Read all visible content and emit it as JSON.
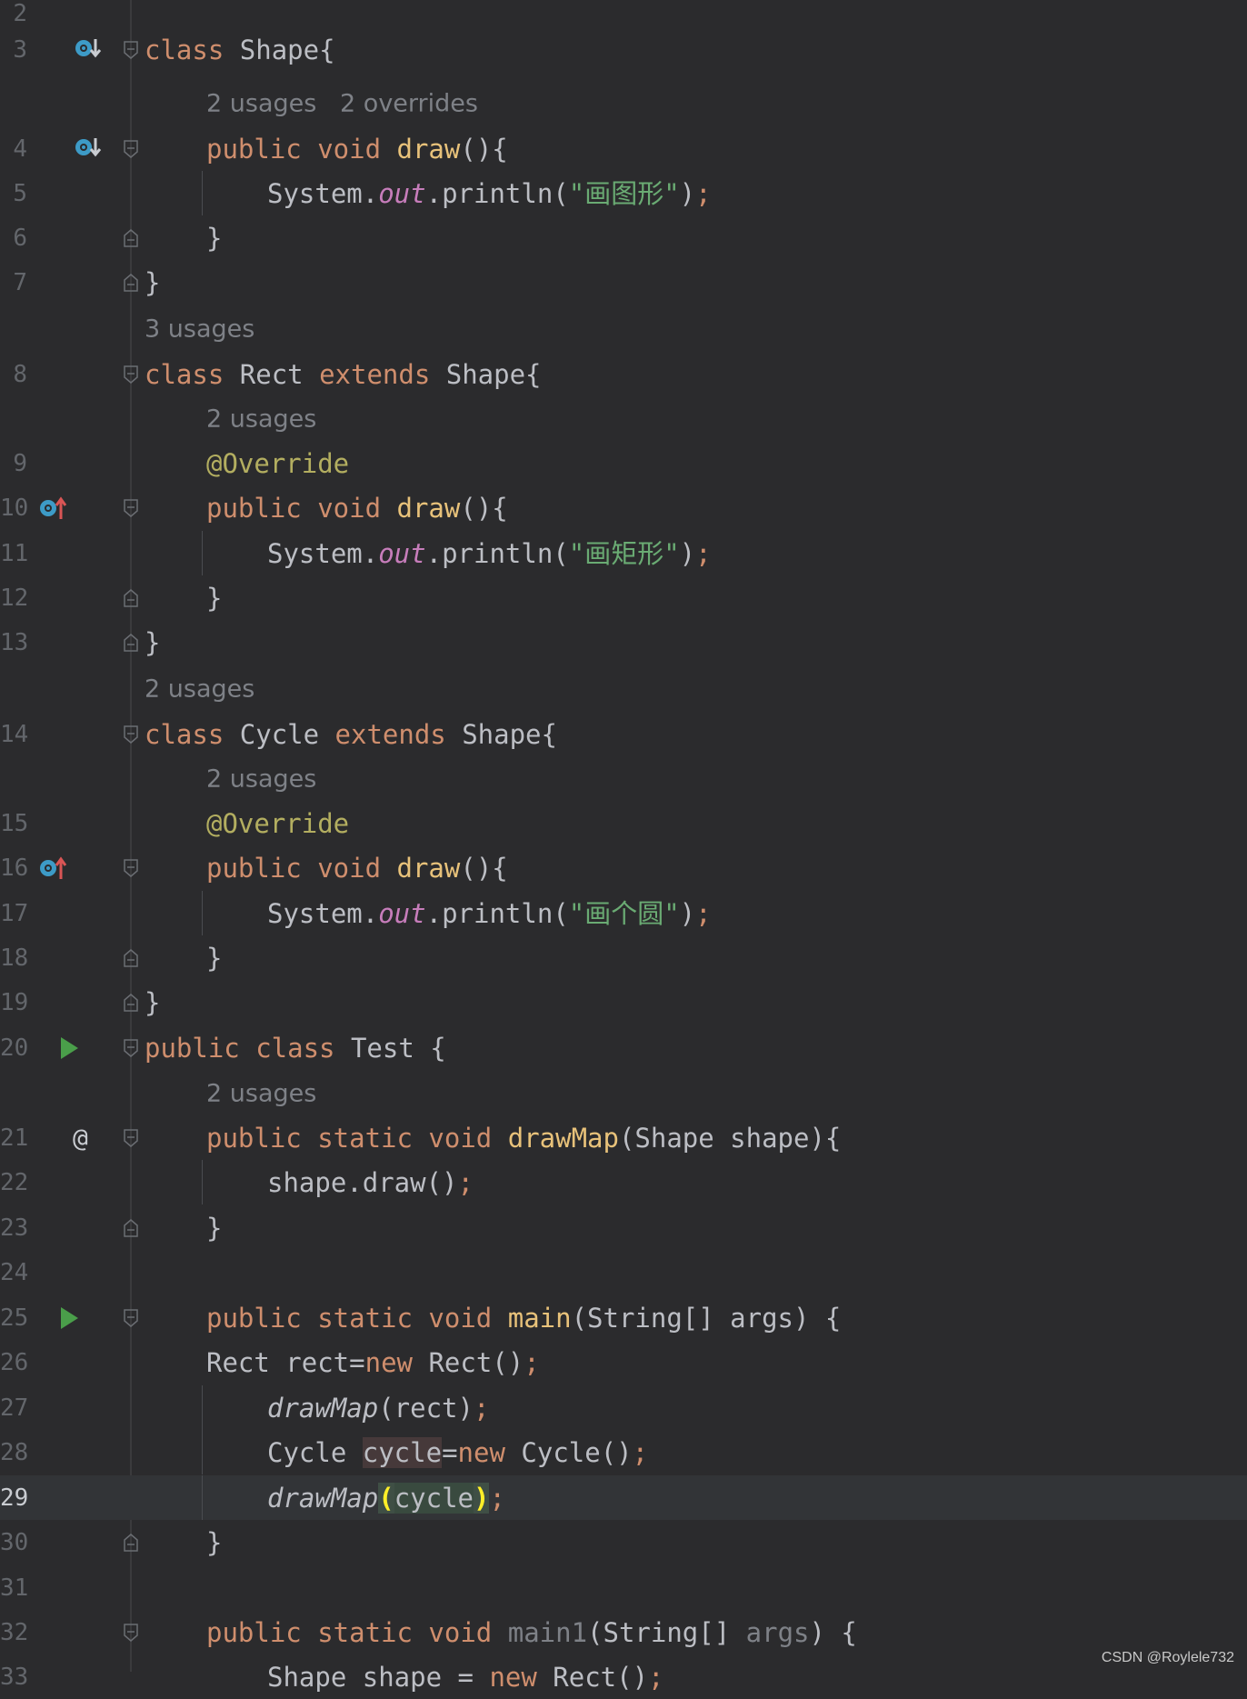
{
  "editor": {
    "language": "Java",
    "current_line": 29,
    "lines": [
      {
        "n": "2"
      },
      {
        "n": "3",
        "code": "class Shape{"
      },
      {
        "hint": "2 usages   2 overrides"
      },
      {
        "n": "4",
        "code": "public void draw(){"
      },
      {
        "n": "5",
        "code": "System.out.println(\"画图形\");"
      },
      {
        "n": "6",
        "code": "}"
      },
      {
        "n": "7",
        "code": "}"
      },
      {
        "hint": "3 usages"
      },
      {
        "n": "8",
        "code": "class Rect extends Shape{"
      },
      {
        "hint": "2 usages"
      },
      {
        "n": "9",
        "code": "@Override"
      },
      {
        "n": "10",
        "code": "public void draw(){"
      },
      {
        "n": "11",
        "code": "System.out.println(\"画矩形\");"
      },
      {
        "n": "12",
        "code": "}"
      },
      {
        "n": "13",
        "code": "}"
      },
      {
        "hint": "2 usages"
      },
      {
        "n": "14",
        "code": "class Cycle extends Shape{"
      },
      {
        "hint": "2 usages"
      },
      {
        "n": "15",
        "code": "@Override"
      },
      {
        "n": "16",
        "code": "public void draw(){"
      },
      {
        "n": "17",
        "code": "System.out.println(\"画个圆\");"
      },
      {
        "n": "18",
        "code": "}"
      },
      {
        "n": "19",
        "code": "}"
      },
      {
        "n": "20",
        "code": "public class Test {"
      },
      {
        "hint": "2 usages"
      },
      {
        "n": "21",
        "code": "public static void drawMap(Shape shape){"
      },
      {
        "n": "22",
        "code": "shape.draw();"
      },
      {
        "n": "23",
        "code": "}"
      },
      {
        "n": "24"
      },
      {
        "n": "25",
        "code": "public static void main(String[] args) {"
      },
      {
        "n": "26",
        "code": "Rect rect=new Rect();"
      },
      {
        "n": "27",
        "code": "drawMap(rect);"
      },
      {
        "n": "28",
        "code": "Cycle cycle=new Cycle();"
      },
      {
        "n": "29",
        "code": "drawMap(cycle);"
      },
      {
        "n": "30",
        "code": "}"
      },
      {
        "n": "31"
      },
      {
        "n": "32",
        "code": "public static void main1(String[] args) {"
      },
      {
        "n": "33",
        "code": "Shape shape = new Rect();"
      }
    ]
  },
  "gutter_icons": {
    "3": "overridden-method-icon",
    "4": "overridden-method-icon",
    "10": "overriding-method-icon",
    "16": "overriding-method-icon",
    "20": "run-icon",
    "21": "at-icon",
    "25": "run-icon"
  },
  "colors": {
    "background": "#2b2b2d",
    "keyword": "#cf8e6d",
    "string": "#6aab73",
    "annotation": "#b3ae60",
    "method_decl": "#e8c27a",
    "static_field": "#c77dbb",
    "hint": "#7e8187",
    "run_icon": "#4a9e4a",
    "gutter_icon": "#3d9bc7",
    "override_arrow": "#d95555"
  },
  "watermark": "CSDN @Roylele732"
}
